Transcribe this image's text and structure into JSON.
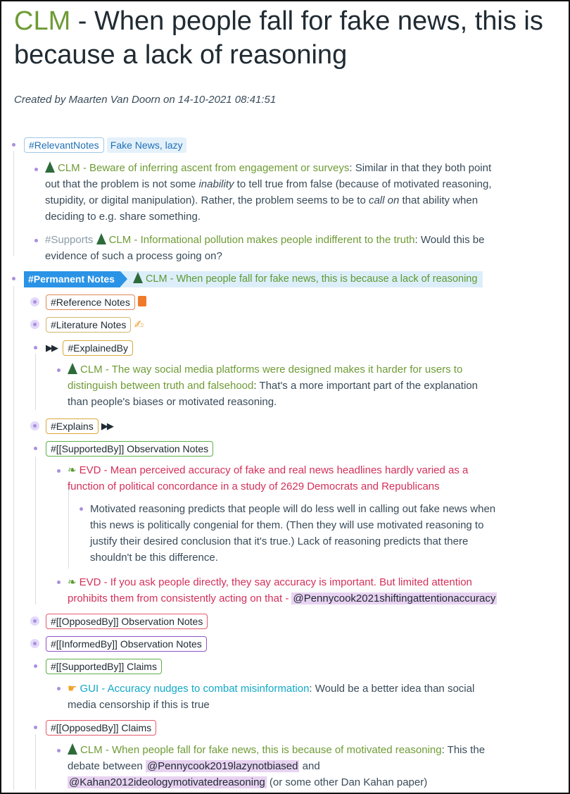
{
  "title": {
    "prefix": "CLM",
    "rest": " - When people fall for fake news, this is because a lack of reasoning"
  },
  "created": "Created by Maarten Van Doorn on 14-10-2021 08:41:51",
  "relevant": {
    "tag": "#RelevantNotes",
    "value": "Fake News, lazy",
    "item1": {
      "link": "CLM - Beware of inferring ascent from engagement or surveys",
      "text_a": ": Similar in that they both point",
      "line2a": "out that the problem is not some ",
      "line2em": "inability",
      "line2b": " to tell true from false (because of motivated reasoning,",
      "line3": "stupidity, or digital manipulation). Rather, the problem seems to be to ",
      "line3em": "call on",
      "line3b": " that ability when",
      "line4": "deciding to e.g. share something."
    },
    "item2": {
      "tag": "#Supports",
      "link": "CLM - Informational pollution makes people indifferent to the truth",
      "text_a": ": Would this be",
      "line2": "evidence of such a process going on?"
    }
  },
  "permanent": {
    "tag": "#Permanent Notes",
    "title": "CLM - When people fall for fake news, this is because a lack of reasoning"
  },
  "reference_tag": "#Reference Notes",
  "literature_tag": "#Literature Notes",
  "explained_by": {
    "tag": "#ExplainedBy",
    "arrows": "▶▶",
    "item": {
      "link": "CLM - The way social media platforms were designed makes it harder for users to",
      "link2": "distinguish between truth and falsehood",
      "text": ": That's a more important part of the explanation",
      "line3": "than people's biases or motivated reasoning."
    }
  },
  "explains": {
    "tag": "#Explains",
    "arrows": "▶▶"
  },
  "supported_obs": {
    "tag": "#[[SupportedBy]] Observation Notes",
    "evd1": {
      "line1": "EVD - Mean perceived accuracy of fake and real news headlines hardly varied as a",
      "line2": "function of political concordance in a study of 2629 Democrats and Republicans",
      "sub1": "Motivated reasoning predicts that people will do less well in calling out fake news when",
      "sub2": "this news is politically congenial for them. (Then they will use motivated reasoning to",
      "sub3": "justify their desired conclusion that it's true.) Lack of reasoning predicts that there",
      "sub4": "shouldn't be this difference."
    },
    "evd2": {
      "line1": "EVD - If you ask people directly, they say accuracy is important. But limited attention",
      "line2": "prohibits them from consistently acting on that - ",
      "ref": "@Pennycook2021shiftingattentionaccuracy"
    }
  },
  "opposed_obs_tag": "#[[OpposedBy]] Observation Notes",
  "informed_obs_tag": "#[[InformedBy]] Observation Notes",
  "supported_claims": {
    "tag": "#[[SupportedBy]] Claims",
    "item": {
      "link": "GUI - Accuracy nudges to combat misinformation",
      "text": ": Would be a better idea than social",
      "line2": "media censorship if this is true"
    }
  },
  "opposed_claims": {
    "tag": "#[[OpposedBy]] Claims",
    "item": {
      "link": "CLM - When people fall for fake news, this is because of motivated reasoning",
      "text": ": This the",
      "line2a": "debate between ",
      "ref1": "@Pennycook2019lazynotbiased",
      "line2b": " and",
      "ref2": "@Kahan2012ideologymotivatedreasoning",
      "line3b": " (or some other Dan Kahan paper)"
    }
  },
  "icons": [
    "tree-icon",
    "book-icon",
    "writing-hand-icon",
    "seedling-icon",
    "pointing-hand-icon",
    "play-arrows-icon"
  ]
}
